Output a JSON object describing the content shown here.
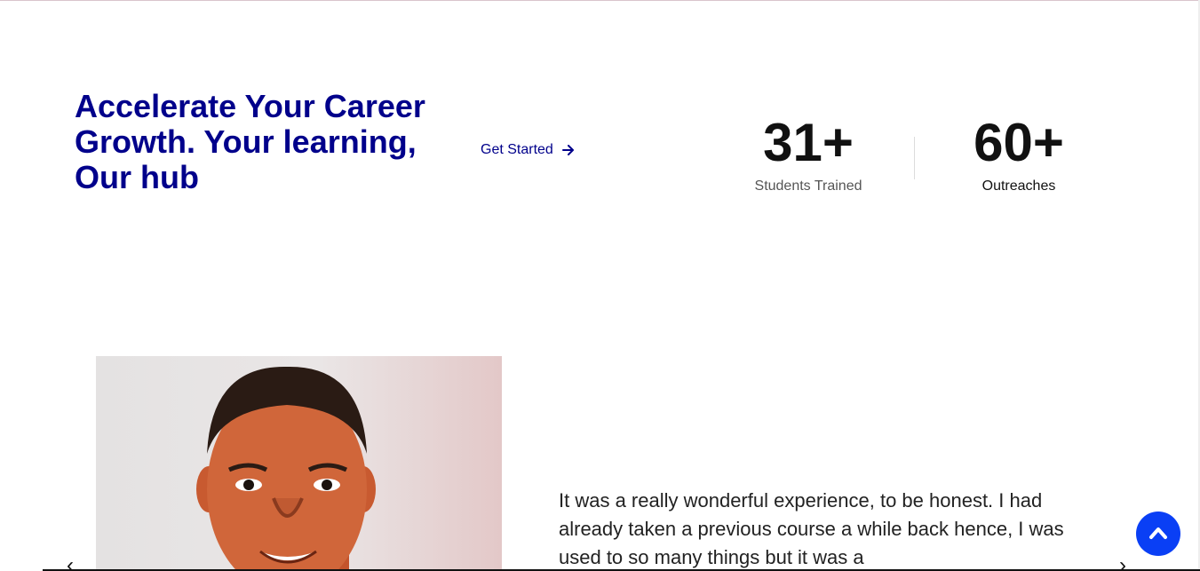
{
  "hero": {
    "title": "Accelerate Your Career Growth. Your learning, Our hub",
    "cta_label": "Get Started"
  },
  "stats": [
    {
      "value": "31+",
      "label": "Students Trained"
    },
    {
      "value": "60+",
      "label": "Outreaches"
    }
  ],
  "testimonial": {
    "text": "It was a really wonderful experience, to be honest. I had already taken a previous course a while back hence, I was used to so many things but it was a"
  },
  "icons": {
    "cta": "arrow-right-icon",
    "prev": "chevron-left-icon",
    "next": "chevron-right-icon",
    "scroll_top": "chevron-up-icon"
  },
  "colors": {
    "brand_navy": "#00008b",
    "scroll_top_bg": "#0a3ff5"
  }
}
